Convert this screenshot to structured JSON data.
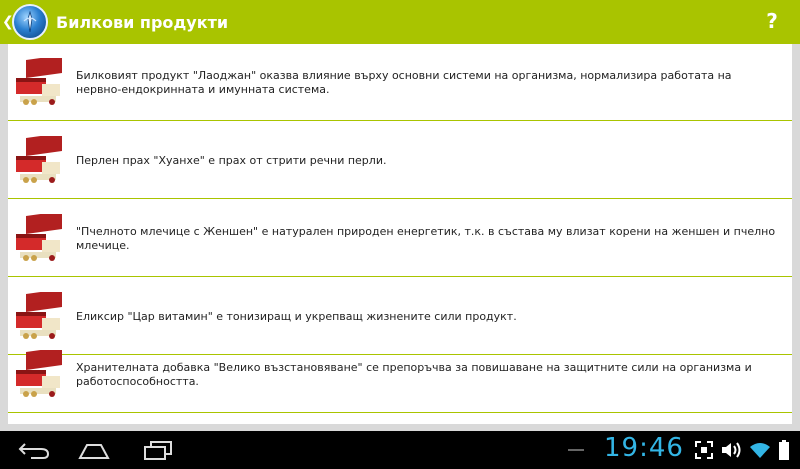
{
  "app": {
    "title": "Билкови продукти",
    "help_label": "?",
    "up_icon": "chevron-left-icon",
    "app_icon": "app-logo-icon"
  },
  "colors": {
    "action_bar": "#a9c400",
    "divider": "#a9c400",
    "clock": "#33b5e5"
  },
  "products": [
    {
      "text": "Билковият продукт \"Лаоджан\" оказва влияние върху основни системи на организма, нормализира работата на нервно-ендокринната и имунната система."
    },
    {
      "text": "Перлен прах \"Хуанхе\" е прах от стрити речни перли."
    },
    {
      "text": "\"Пчелното млечице с Женшен\" е натурален природен енергетик, т.к. в състава му влизат корени на женшен и пчелно млечице."
    },
    {
      "text": "Еликсир \"Цар витамин\" е тонизиращ и укрепващ жизнените сили продукт."
    },
    {
      "text": "Хранителната добавка \"Велико възстановяване\" се препоръчва за повишаване на защитните сили на организма и работоспособността."
    }
  ],
  "system_bar": {
    "time": "19:46",
    "buttons": [
      "back-icon",
      "home-icon",
      "recent-apps-icon"
    ],
    "status_icons": [
      "screenshot-icon",
      "volume-icon",
      "wifi-icon",
      "battery-icon"
    ]
  }
}
